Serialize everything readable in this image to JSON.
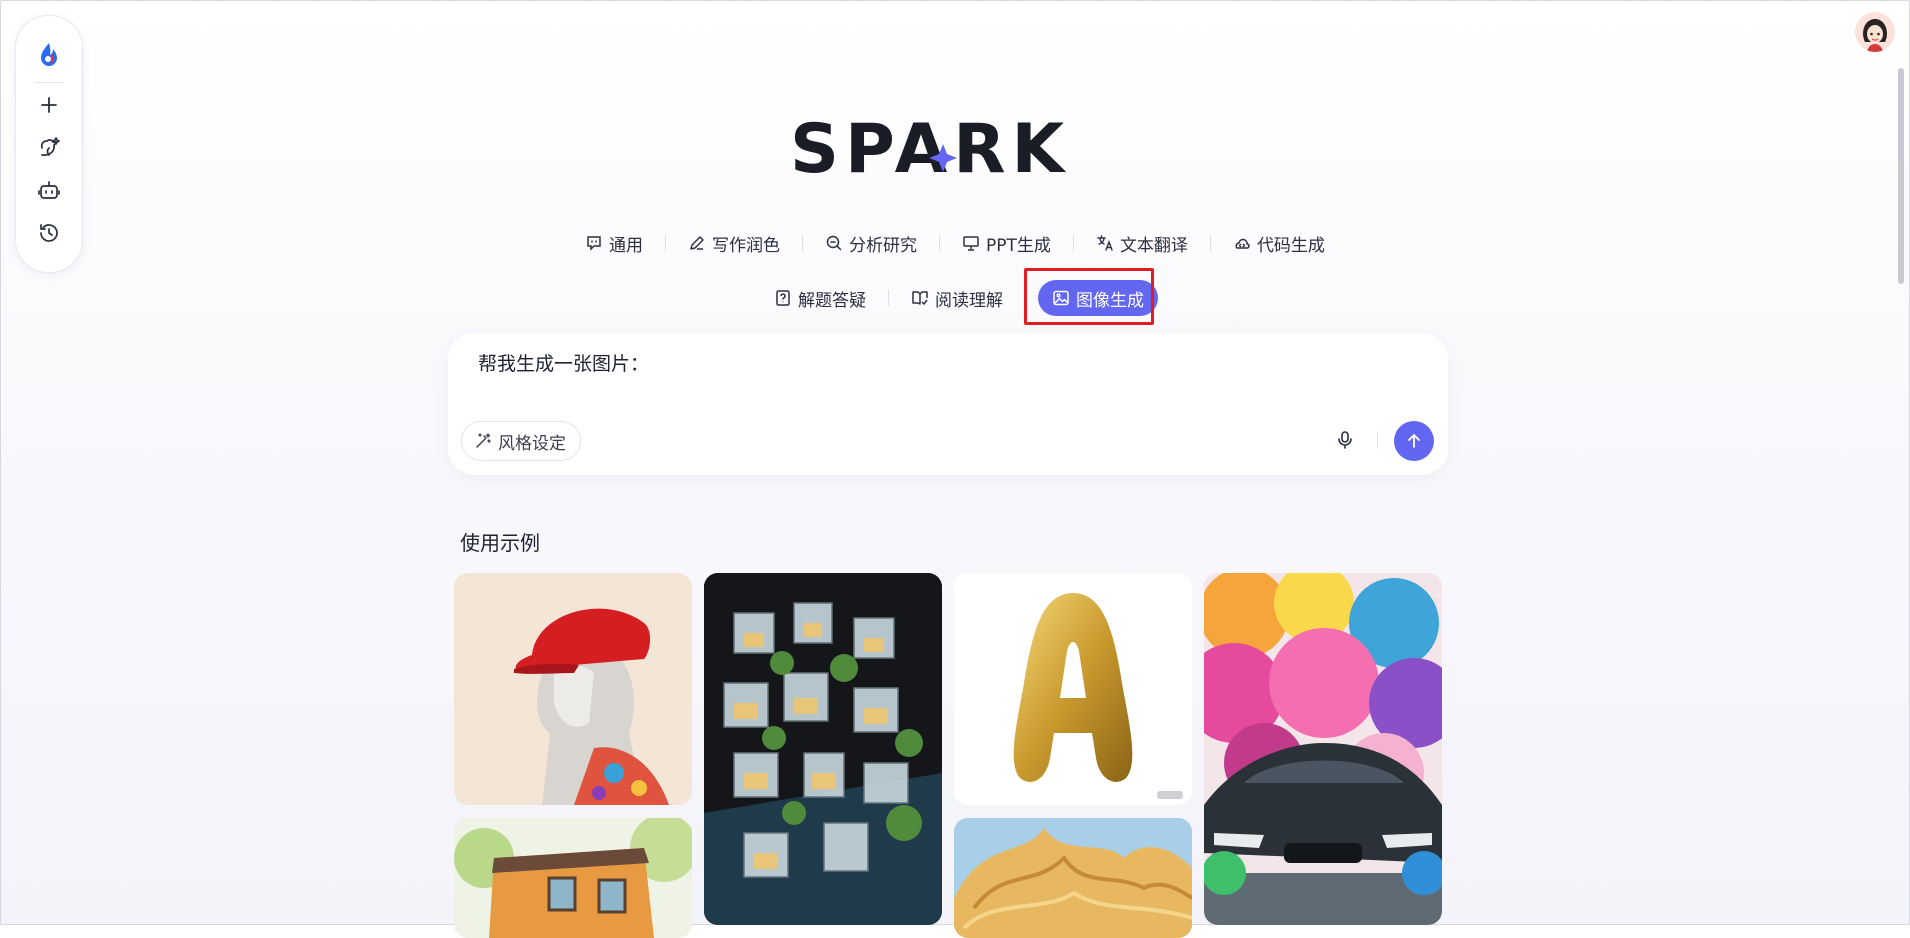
{
  "brand": {
    "logo_text": "SPARK",
    "accent": "#6366f1"
  },
  "rail": {
    "items": [
      {
        "icon": "app-logo-icon"
      },
      {
        "icon": "plus-icon"
      },
      {
        "icon": "bird-icon"
      },
      {
        "icon": "robot-icon"
      },
      {
        "icon": "history-icon"
      }
    ]
  },
  "tabs_row1": [
    {
      "label": "通用",
      "icon": "chat-bubble-icon"
    },
    {
      "label": "写作润色",
      "icon": "pen-icon"
    },
    {
      "label": "分析研究",
      "icon": "magnifier-icon"
    },
    {
      "label": "PPT生成",
      "icon": "presentation-icon"
    },
    {
      "label": "文本翻译",
      "icon": "translate-icon"
    },
    {
      "label": "代码生成",
      "icon": "code-icon"
    }
  ],
  "tabs_row2": [
    {
      "label": "解题答疑",
      "icon": "question-icon"
    },
    {
      "label": "阅读理解",
      "icon": "book-icon"
    },
    {
      "label": "图像生成",
      "icon": "image-icon",
      "active": true
    }
  ],
  "input": {
    "prompt_prefix": "帮我生成一张图片：",
    "style_button": "风格设定"
  },
  "examples": {
    "title": "使用示例",
    "images": [
      {
        "name": "statue-red-cap-image"
      },
      {
        "name": "glass-miniature-town-image"
      },
      {
        "name": "golden-balloon-letter-a-image"
      },
      {
        "name": "sports-car-color-smoke-image"
      },
      {
        "name": "watercolor-house-image"
      },
      {
        "name": "golden-hair-image"
      }
    ]
  }
}
